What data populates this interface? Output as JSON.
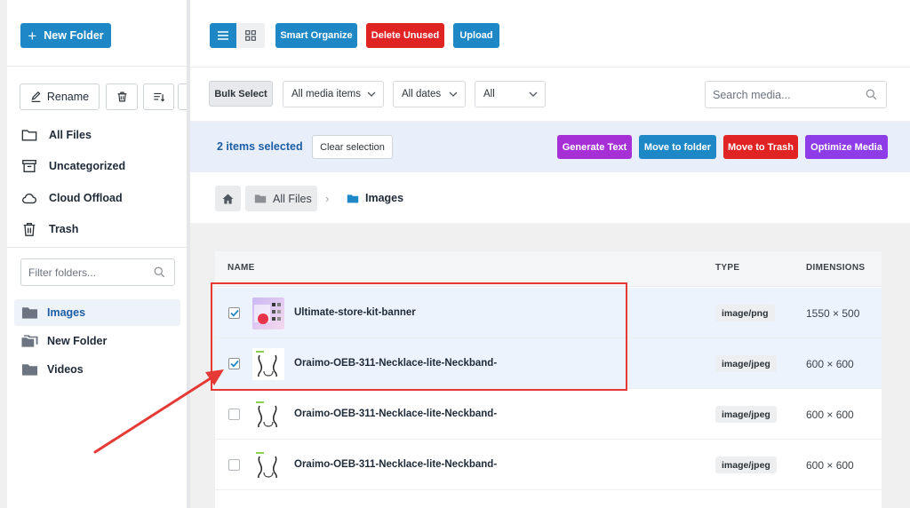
{
  "sidebar": {
    "new_folder_label": "New Folder",
    "rename_label": "Rename",
    "nav": [
      {
        "label": "All Files",
        "icon": "folder-outline-icon"
      },
      {
        "label": "Uncategorized",
        "icon": "archive-icon"
      },
      {
        "label": "Cloud Offload",
        "icon": "cloud-icon"
      },
      {
        "label": "Trash",
        "icon": "trash-icon"
      }
    ],
    "filter_placeholder": "Filter folders...",
    "folders": [
      {
        "label": "Images",
        "active": true
      },
      {
        "label": "New Folder",
        "active": false
      },
      {
        "label": "Videos",
        "active": false
      }
    ]
  },
  "toolbar": {
    "smart_organize": "Smart Organize",
    "delete_unused": "Delete Unused",
    "upload": "Upload"
  },
  "filters": {
    "bulk_select": "Bulk Select",
    "media_type": "All media items",
    "dates": "All dates",
    "all": "All",
    "search_placeholder": "Search media..."
  },
  "selection": {
    "count_text": "2 items selected",
    "clear_label": "Clear selection",
    "generate_text": "Generate Text",
    "move_to_folder": "Move to folder",
    "move_to_trash": "Move to Trash",
    "optimize_media": "Optimize Media"
  },
  "breadcrumb": {
    "root": "All Files",
    "current": "Images"
  },
  "table": {
    "headers": {
      "name": "NAME",
      "type": "TYPE",
      "dimensions": "DIMENSIONS"
    },
    "rows": [
      {
        "name": "Ultimate-store-kit-banner",
        "type": "image/png",
        "dimensions": "1550 × 500",
        "checked": true,
        "thumb": "banner"
      },
      {
        "name": "Oraimo-OEB-311-Necklace-lite-Neckband-",
        "type": "image/jpeg",
        "dimensions": "600 × 600",
        "checked": true,
        "thumb": "neckband"
      },
      {
        "name": "Oraimo-OEB-311-Necklace-lite-Neckband-",
        "type": "image/jpeg",
        "dimensions": "600 × 600",
        "checked": false,
        "thumb": "neckband"
      },
      {
        "name": "Oraimo-OEB-311-Necklace-lite-Neckband-",
        "type": "image/jpeg",
        "dimensions": "600 × 600",
        "checked": false,
        "thumb": "neckband"
      }
    ]
  },
  "colors": {
    "primary": "#1e88c7",
    "danger": "#e02424",
    "purple": "#a62fd6",
    "violet": "#8e3ce8",
    "annotation": "#e53935"
  }
}
